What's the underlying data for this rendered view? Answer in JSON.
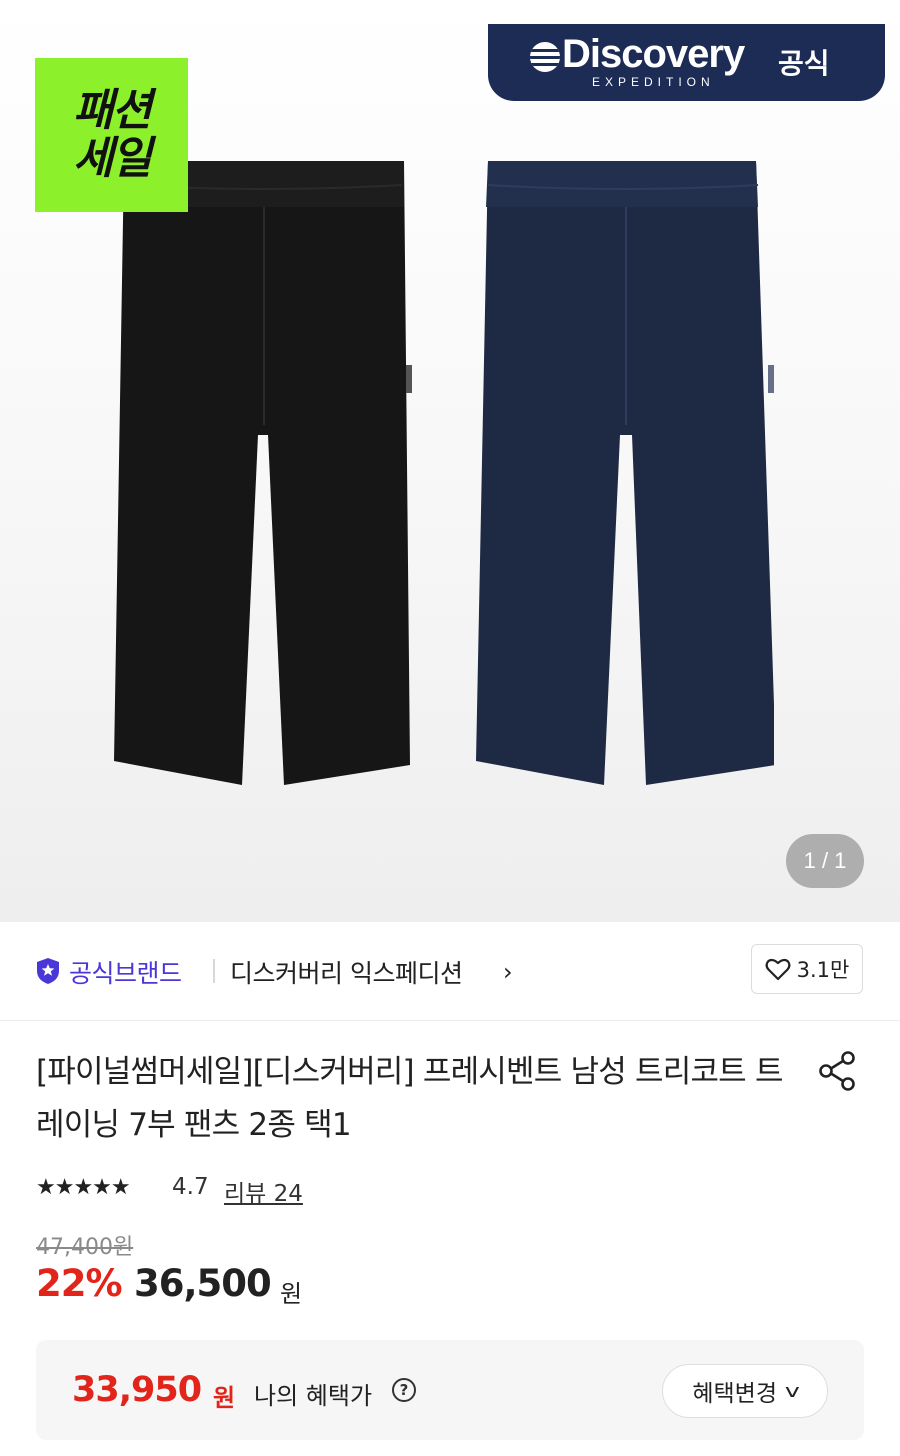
{
  "hero": {
    "sale_badge_line1": "패션",
    "sale_badge_line2": "세일",
    "brand_name": "Discovery",
    "brand_sub": "EXPEDITION",
    "brand_official": "공식",
    "page_counter": "1 / 1",
    "colors": {
      "badge": "#8cf02b",
      "banner": "#1c2c55",
      "pants_left": "#161616",
      "pants_right": "#1e2a44"
    }
  },
  "brand_row": {
    "official_label": "공식브랜드",
    "brand_link": "디스커버리 익스페디션",
    "chevron": "›",
    "like_count": "3.1만"
  },
  "product": {
    "title": "[파이널썸머세일][디스커버리] 프레시벤트 남성 트리코트 트레이닝 7부 팬츠 2종 택1",
    "stars": "★★★★★",
    "rating": "4.7",
    "review_link": "리뷰 24",
    "original_price": "47,400원",
    "discount": "22%",
    "sale_price": "36,500",
    "sale_unit": "원"
  },
  "benefit": {
    "price": "33,950",
    "unit": "원",
    "label": "나의 혜택가",
    "help": "?",
    "change_button": "혜택변경",
    "change_chevron": "v"
  }
}
